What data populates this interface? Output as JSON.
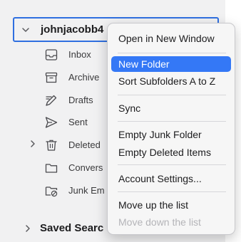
{
  "colors": {
    "accent": "#3478f6",
    "focus_border": "#2f6fe0",
    "sidebar_bg": "#f1f1f2",
    "disabled_text": "#b4b4b8"
  },
  "sidebar": {
    "account": {
      "name": "johnjacobb4",
      "chevron_icon": "chevron-down-icon"
    },
    "folders": [
      {
        "label": "Inbox",
        "icon": "inbox-icon"
      },
      {
        "label": "Archive",
        "icon": "archive-icon"
      },
      {
        "label": "Drafts",
        "icon": "drafts-icon"
      },
      {
        "label": "Sent",
        "icon": "sent-icon"
      },
      {
        "label": "Deleted",
        "icon": "trash-icon",
        "expandable": true
      },
      {
        "label": "Convers",
        "icon": "folder-icon"
      },
      {
        "label": "Junk Em",
        "icon": "junk-icon"
      }
    ],
    "saved_searches": {
      "label": "Saved Searc",
      "chevron_icon": "chevron-right-icon"
    }
  },
  "context_menu": {
    "items": [
      {
        "label": "Open in New Window",
        "state": "normal"
      },
      {
        "label": "New Folder",
        "state": "highlighted"
      },
      {
        "label": "Sort Subfolders A to Z",
        "state": "normal"
      },
      {
        "label": "Sync",
        "state": "normal"
      },
      {
        "label": "Empty Junk Folder",
        "state": "normal"
      },
      {
        "label": "Empty Deleted Items",
        "state": "normal"
      },
      {
        "label": "Account Settings...",
        "state": "normal"
      },
      {
        "label": "Move up the list",
        "state": "normal"
      },
      {
        "label": "Move down the list",
        "state": "disabled"
      }
    ]
  }
}
